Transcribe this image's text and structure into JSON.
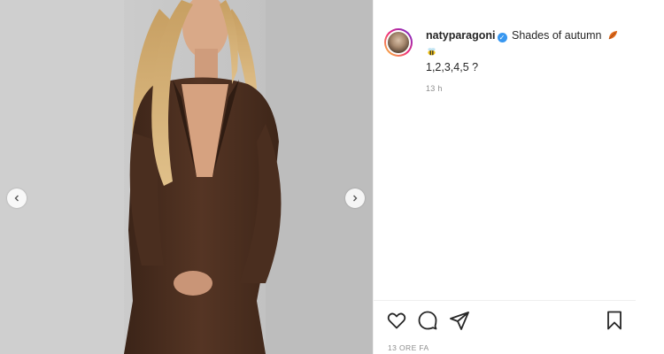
{
  "post": {
    "username": "natyparagoni",
    "caption": "Shades of autumn",
    "caption_line2": "1,2,3,4,5 ?",
    "time_short": "13 h",
    "time_long": "13 ORE FA"
  },
  "icons": {
    "verified": "verified-badge-icon",
    "leaf": "autumn-leaf-emoji",
    "bee": "bee-emoji",
    "like": "heart-icon",
    "comment": "comment-icon",
    "share": "paper-plane-icon",
    "save": "bookmark-icon",
    "prev": "chevron-left-icon",
    "next": "chevron-right-icon"
  },
  "colors": {
    "accent": "#3897f0",
    "text": "#262626",
    "muted": "#8e8e8e",
    "dress": "#4a2f20"
  }
}
